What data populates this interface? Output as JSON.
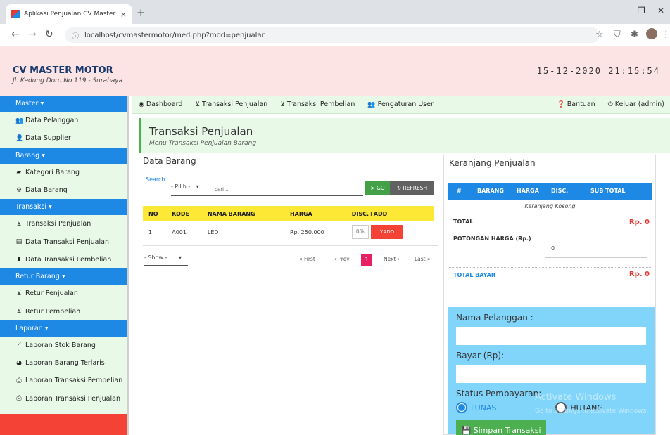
{
  "browser": {
    "tab_title": "Aplikasi Penjualan CV Master Mo",
    "tab_close": "×",
    "new_tab": "+",
    "url": "localhost/cvmastermotor/med.php?mod=penjualan",
    "minimize": "–",
    "restore": "❐",
    "close": "✕"
  },
  "header": {
    "brand": "CV MASTER MOTOR",
    "address": "Jl. Kedung Doro No 119 - Surabaya",
    "datetime": "15-12-2020 21:15:54"
  },
  "topnav": {
    "items": [
      "Dashboard",
      "Transaksi Penjualan",
      "Transaksi Pembelian",
      "Pengaturan User"
    ],
    "help": "Bantuan",
    "logout": "Keluar (admin)"
  },
  "sidebar": {
    "master": "Master ▾",
    "pelanggan": "Data Pelanggan",
    "supplier": "Data Supplier",
    "barang_head": "Barang ▾",
    "kategori": "Kategori Barang",
    "data_barang": "Data Barang",
    "transaksi_head": "Transaksi ▾",
    "trans_penjualan": "Transaksi Penjualan",
    "data_trans_penjualan": "Data Transaksi Penjualan",
    "data_trans_pembelian": "Data Transaksi Pembelian",
    "retur_head": "Retur Barang ▾",
    "retur_penjualan": "Retur Penjualan",
    "retur_pembelian": "Retur Pembelian",
    "laporan_head": "Laporan ▾",
    "lap_stok": "Laporan Stok Barang",
    "lap_terlaris": "Laporan Barang Terlaris",
    "lap_pembelian": "Laporan Transaksi Pembelian",
    "lap_penjualan": "Laporan Transaksi Penjualan"
  },
  "page": {
    "title": "Transaksi Penjualan",
    "subtitle": "Menu Transaksi Penjualan Barang"
  },
  "data_barang": {
    "title": "Data Barang",
    "search_label": "Search",
    "pilih": "- Pilih -",
    "cari_placeholder": "cari ...",
    "go": "GO",
    "refresh": "REFRESH",
    "columns": [
      "NO",
      "KODE",
      "NAMA BARANG",
      "HARGA",
      "DISC.+ADD"
    ],
    "rows": [
      {
        "no": "1",
        "kode": "A001",
        "nama": "LED",
        "harga": "Rp. 250.000",
        "disc": "0%",
        "add": "ADD"
      }
    ],
    "show": "- Show -",
    "first": "« First",
    "prev": "‹ Prev",
    "page": "1",
    "next": "Next ›",
    "last": "Last »"
  },
  "cart": {
    "title": "Keranjang Penjualan",
    "columns": [
      "#",
      "BARANG",
      "HARGA",
      "DISC.",
      "SUB TOTAL"
    ],
    "empty": "Keranjang Kosong",
    "total_label": "TOTAL",
    "total_value": "Rp. 0",
    "potongan_label": "POTONGAN HARGA (Rp.)",
    "potongan_value": "0",
    "total_bayar_label": "TOTAL BAYAR",
    "total_bayar_value": "Rp. 0"
  },
  "form": {
    "nama_label": "Nama Pelanggan :",
    "bayar_label": "Bayar (Rp):",
    "status_label": "Status Pembayaran:",
    "lunas": "LUNAS",
    "hutang": "HUTANG",
    "save": "Simpan Transaksi"
  },
  "watermark": {
    "line1": "Activate Windows",
    "line2": "Go to Settings to activate Windows."
  }
}
